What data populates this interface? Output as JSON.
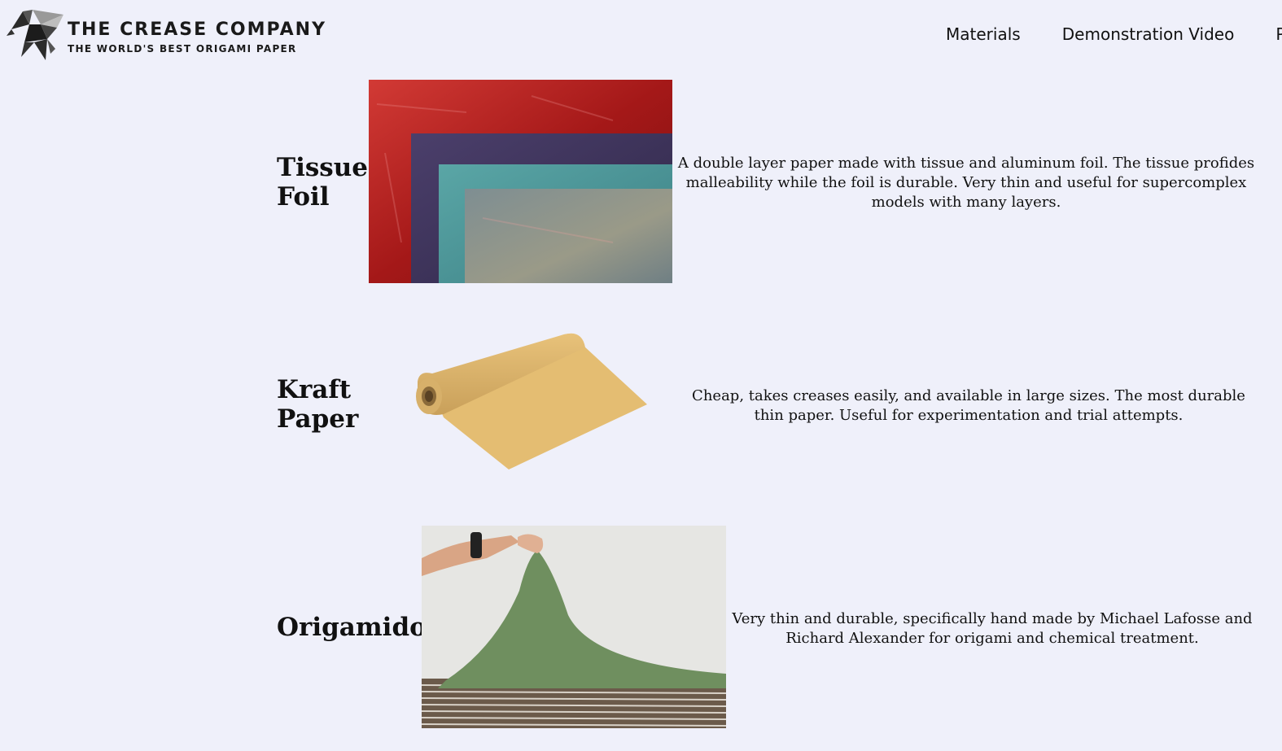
{
  "brand": {
    "name": "THE CREASE COMPANY",
    "tagline": "THE WORLD'S BEST ORIGAMI PAPER",
    "logo_icon": "origami-pegasus-icon"
  },
  "nav": {
    "items": [
      {
        "label": "Materials"
      },
      {
        "label": "Demonstration Video"
      },
      {
        "label": "P"
      }
    ]
  },
  "materials": [
    {
      "name_line1": "Tissue",
      "name_line2": "Foil",
      "description": "A double layer paper made with tissue and aluminum foil. The tissue profides malleability while the foil is durable. Very thin and useful for supercomplex models with many layers.",
      "image": "tissue-foil-sheets-image"
    },
    {
      "name_line1": "Kraft",
      "name_line2": "Paper",
      "description": "Cheap, takes creases easily, and available in large sizes. The most durable thin paper. Useful for experimentation and trial attempts.",
      "image": "kraft-paper-roll-image"
    },
    {
      "name_line1": "Origamido",
      "name_line2": "",
      "description": "Very thin and durable, specifically hand made by Michael Lafosse and Richard Alexander for origami and chemical treatment.",
      "image": "origamido-paper-image"
    }
  ],
  "colors": {
    "background": "#eff0fa",
    "text": "#111111"
  }
}
